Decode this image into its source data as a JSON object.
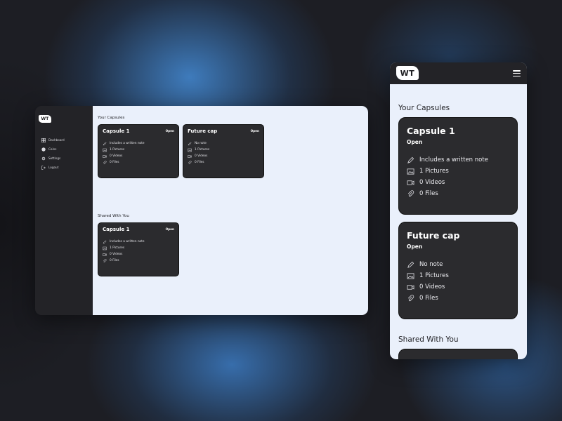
{
  "brand": {
    "logo_text": "WT"
  },
  "nav": {
    "items": [
      {
        "label": "Dashboard",
        "icon": "dashboard-icon"
      },
      {
        "label": "Coins",
        "icon": "coin-icon"
      },
      {
        "label": "Settings",
        "icon": "gear-icon"
      },
      {
        "label": "Logout",
        "icon": "logout-icon"
      }
    ]
  },
  "sections": {
    "your_capsules": "Your Capsules",
    "shared_with_you": "Shared With You"
  },
  "desktop": {
    "capsules": [
      {
        "title": "Capsule 1",
        "status": "Open",
        "note": "Includes a written note",
        "pictures": "1 Pictures",
        "videos": "0 Videos",
        "files": "0 Files"
      },
      {
        "title": "Future cap",
        "status": "Open",
        "note": "No note",
        "pictures": "1 Pictures",
        "videos": "0 Videos",
        "files": "0 Files"
      }
    ],
    "shared": [
      {
        "title": "Capsule 1",
        "status": "Open",
        "note": "Includes a written note",
        "pictures": "1 Pictures",
        "videos": "0 Videos",
        "files": "0 Files"
      }
    ]
  },
  "mobile": {
    "capsules": [
      {
        "title": "Capsule 1",
        "status": "Open",
        "note": "Includes a written note",
        "pictures": "1 Pictures",
        "videos": "0 Videos",
        "files": "0 Files"
      },
      {
        "title": "Future cap",
        "status": "Open",
        "note": "No note",
        "pictures": "1 Pictures",
        "videos": "0 Videos",
        "files": "0 Files"
      }
    ]
  },
  "colors": {
    "sidebar": "#232327",
    "content_bg": "#eaf0fb",
    "card": "#2b2b2e",
    "glow": "#3f80c4"
  }
}
